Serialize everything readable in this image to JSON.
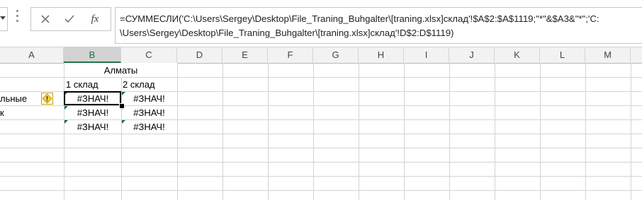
{
  "formula_bar": {
    "formula_line1": "=СУММЕСЛИ('C:\\Users\\Sergey\\Desktop\\File_Traning_Buhgalter\\[traning.xlsx]склад'!$A$2:$A$1119;\"*\"&$A3&\"*\";'C:",
    "formula_line2": "\\Users\\Sergey\\Desktop\\File_Traning_Buhgalter\\[traning.xlsx]склад'!D$2:D$1119)",
    "cancel_icon": "close-icon",
    "enter_icon": "check-icon",
    "function_label": "fx"
  },
  "columns": [
    "A",
    "B",
    "C",
    "D",
    "E",
    "F",
    "G",
    "H",
    "I",
    "J",
    "K",
    "L",
    "M"
  ],
  "selected_column": "B",
  "cells": {
    "b1_c1": "Алматы",
    "b2": "1 склад",
    "c2": "2 склад",
    "a3": "льные",
    "a4": "к",
    "b3": "#ЗНАЧ!",
    "c3": "#ЗНАЧ!",
    "b4": "#ЗНАЧ!",
    "c4": "#ЗНАЧ!",
    "b5": "#ЗНАЧ!",
    "c5": "#ЗНАЧ!"
  },
  "colors": {
    "accent": "#217346",
    "error_marker": "#1e6b3a",
    "warning": "#f5d234"
  }
}
